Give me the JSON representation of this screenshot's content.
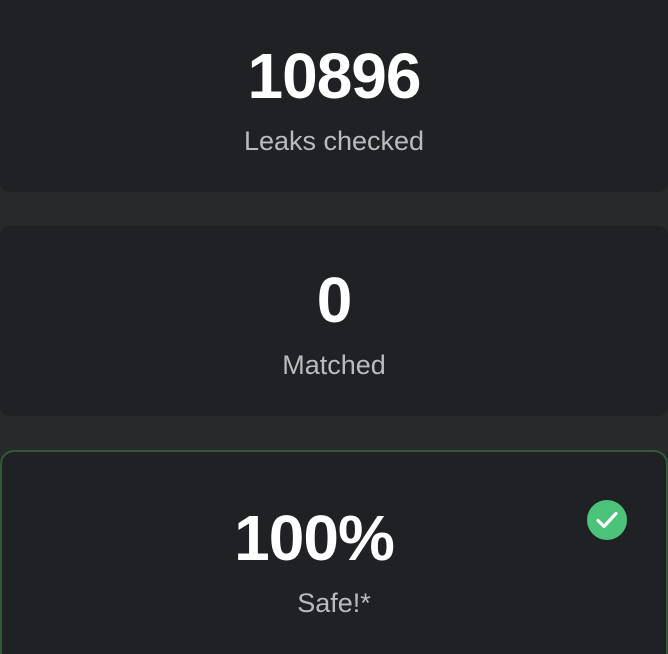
{
  "stats": {
    "checked": {
      "value": "10896",
      "label": "Leaks checked"
    },
    "matched": {
      "value": "0",
      "label": "Matched"
    },
    "safe": {
      "value": "100%",
      "label": "Safe!*",
      "icon": "check-circle-icon"
    }
  },
  "colors": {
    "background": "#27292b",
    "card": "#202124",
    "safe_border": "#2f5a35",
    "check_green": "#4cc27a",
    "value_text": "#ffffff",
    "label_text": "#b9bbbe"
  }
}
